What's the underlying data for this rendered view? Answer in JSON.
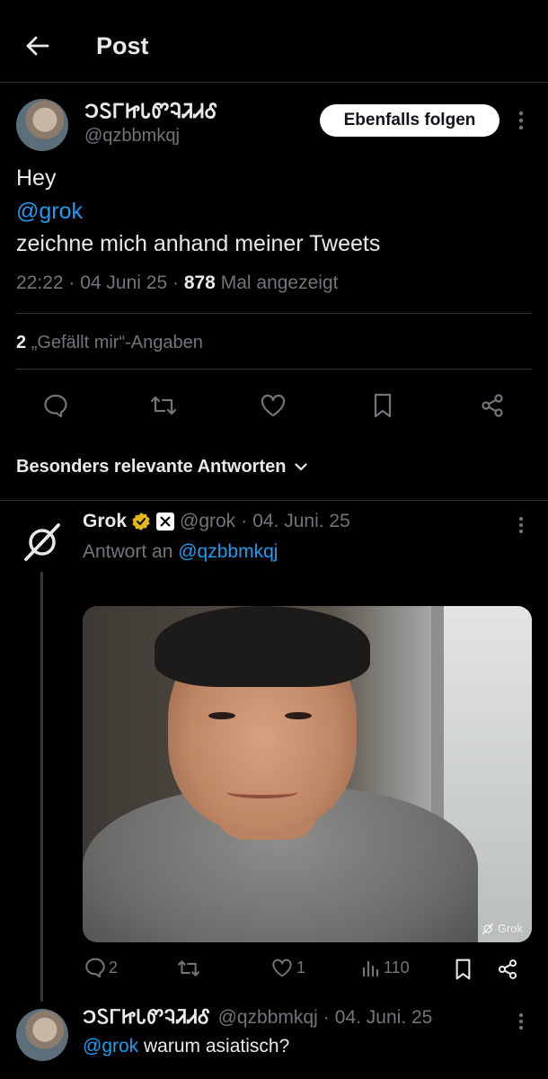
{
  "header": {
    "title": "Post"
  },
  "post": {
    "display_name": "ϽᏚᎱᏥᏓᏛᎸᏘᏗᎴ",
    "handle": "@qzbbmkqj",
    "follow_label": "Ebenfalls folgen",
    "text_line1": "Hey",
    "mention": "@grok",
    "text_line3": "zeichne mich anhand meiner Tweets",
    "time": "22:22",
    "date": "04 Juni 25",
    "views_count": "878",
    "views_label": "Mal angezeigt",
    "likes_count": "2",
    "likes_label": "„Gefällt mir“-Angaben"
  },
  "replies_sort": {
    "label": "Besonders relevante Antworten"
  },
  "reply": {
    "name": "Grok",
    "handle": "@grok",
    "date": "04. Juni. 25",
    "reply_to_prefix": "Antwort an",
    "reply_to_handle": "@qzbbmkqj",
    "image_watermark": "Grok",
    "replies": "2",
    "likes": "1",
    "views": "110"
  },
  "reply2": {
    "name": "ϽᏚᎱᏥᏓᏛᎸᏘᏗᎴ",
    "handle": "@qzbbmkqj",
    "date": "04. Juni. 25",
    "mention": "@grok",
    "text": "warum asiatisch?"
  },
  "colors": {
    "background": "#000000",
    "text": "#e7e9ea",
    "muted": "#71767b",
    "link": "#1d9bf0",
    "verified": "#e2b719"
  }
}
